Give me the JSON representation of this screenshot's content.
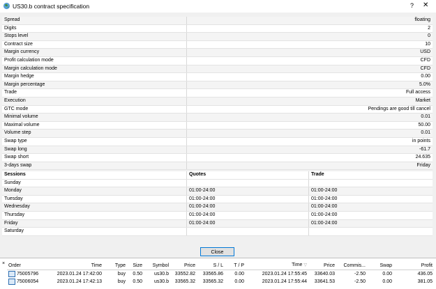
{
  "window": {
    "title": "US30.b contract specification",
    "help": "?",
    "close": "✕"
  },
  "spec": [
    {
      "label": "Spread",
      "value": "floating"
    },
    {
      "label": "Digits",
      "value": "2"
    },
    {
      "label": "Stops level",
      "value": "0"
    },
    {
      "label": "Contract size",
      "value": "10"
    },
    {
      "label": "Margin currency",
      "value": "USD"
    },
    {
      "label": "Profit calculation mode",
      "value": "CFD"
    },
    {
      "label": "Margin calculation mode",
      "value": "CFD"
    },
    {
      "label": "Margin hedge",
      "value": "0.00"
    },
    {
      "label": "Margin percentage",
      "value": "5.0%"
    },
    {
      "label": "Trade",
      "value": "Full access"
    },
    {
      "label": "Execution",
      "value": "Market"
    },
    {
      "label": "GTC mode",
      "value": "Pendings are good till cancel"
    },
    {
      "label": "Minimal volume",
      "value": "0.01"
    },
    {
      "label": "Maximal volume",
      "value": "50.00"
    },
    {
      "label": "Volume step",
      "value": "0.01"
    },
    {
      "label": "Swap type",
      "value": "in points"
    },
    {
      "label": "Swap long",
      "value": "-61.7"
    },
    {
      "label": "Swap short",
      "value": "24.635"
    },
    {
      "label": "3-days swap",
      "value": "Friday"
    }
  ],
  "sessions": {
    "headers": {
      "day": "Sessions",
      "quotes": "Quotes",
      "trade": "Trade"
    },
    "rows": [
      {
        "day": "Sunday",
        "quotes": "",
        "trade": ""
      },
      {
        "day": "Monday",
        "quotes": "01:00-24:00",
        "trade": "01:00-24:00"
      },
      {
        "day": "Tuesday",
        "quotes": "01:00-24:00",
        "trade": "01:00-24:00"
      },
      {
        "day": "Wednesday",
        "quotes": "01:00-24:00",
        "trade": "01:00-24:00"
      },
      {
        "day": "Thursday",
        "quotes": "01:00-24:00",
        "trade": "01:00-24:00"
      },
      {
        "day": "Friday",
        "quotes": "01:00-24:00",
        "trade": "01:00-24:00"
      },
      {
        "day": "Saturday",
        "quotes": "",
        "trade": ""
      }
    ]
  },
  "close_label": "Close",
  "trades": {
    "close_x": "×",
    "sort_icon": "▽",
    "headers": [
      "Order",
      "Time",
      "Type",
      "Size",
      "Symbol",
      "Price",
      "S / L",
      "T / P",
      "Time",
      "Price",
      "Commis...",
      "Swap",
      "Profit"
    ],
    "rows": [
      [
        "75005796",
        "2023.01.24 17:42:00",
        "buy",
        "0.50",
        "us30.b",
        "33552.82",
        "33565.86",
        "0.00",
        "2023.01.24 17:55:45",
        "33640.03",
        "-2.50",
        "0.00",
        "436.05"
      ],
      [
        "75006054",
        "2023.01.24 17:42:13",
        "buy",
        "0.50",
        "us30.b",
        "33565.32",
        "33565.32",
        "0.00",
        "2023.01.24 17:55:44",
        "33641.53",
        "-2.50",
        "0.00",
        "381.05"
      ]
    ]
  },
  "colors": {
    "accent": "#0078d7",
    "icon": "#2b8a3e"
  }
}
